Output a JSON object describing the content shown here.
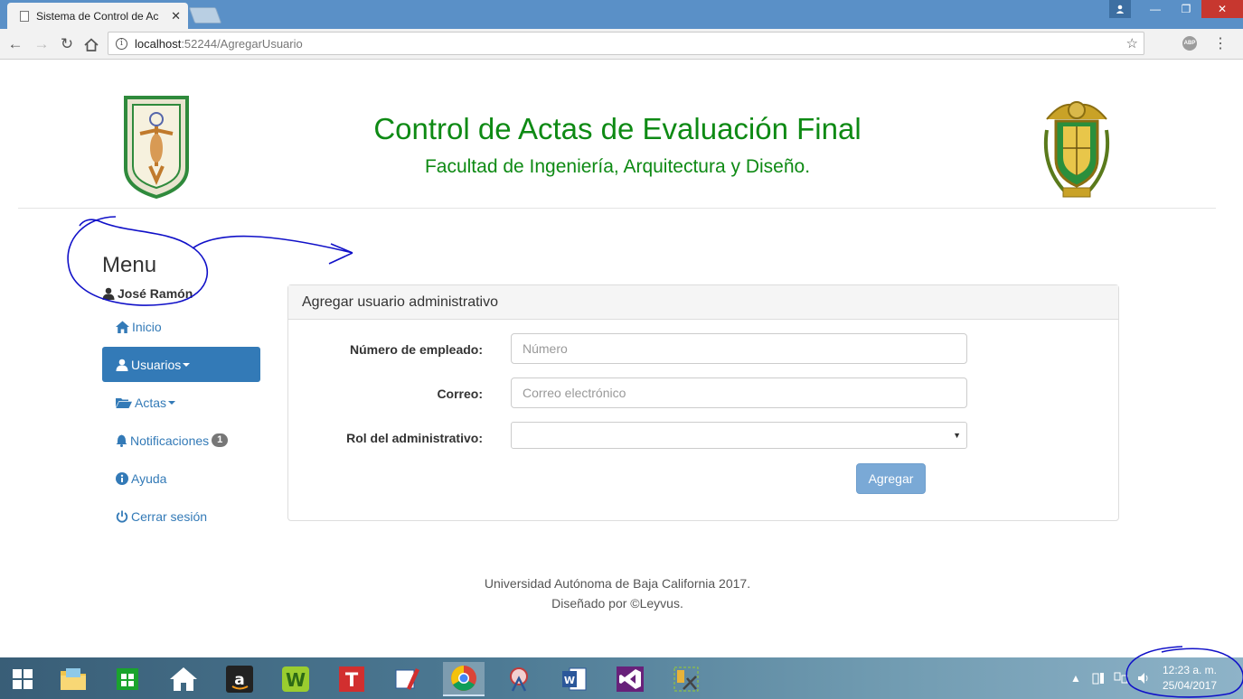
{
  "browser": {
    "tab_title": "Sistema de Control de Ac",
    "url_host": "localhost",
    "url_path": ":52244/AgregarUsuario",
    "abp_label": "ABP"
  },
  "header": {
    "title": "Control de Actas de Evaluación Final",
    "subtitle": "Facultad de Ingeniería, Arquitectura y Diseño."
  },
  "sidebar": {
    "heading": "Menu",
    "user": "José Ramón",
    "items": [
      {
        "label": "Inicio",
        "icon": "home-icon"
      },
      {
        "label": "Usuarios",
        "icon": "user-icon"
      },
      {
        "label": "Actas",
        "icon": "folder-open-icon"
      },
      {
        "label": "Notificaciones",
        "icon": "bell-icon",
        "badge": "1"
      },
      {
        "label": "Ayuda",
        "icon": "info-circle-icon"
      },
      {
        "label": "Cerrar sesión",
        "icon": "power-icon"
      }
    ]
  },
  "panel": {
    "title": "Agregar usuario administrativo",
    "fields": {
      "employee": {
        "label": "Número de empleado:",
        "placeholder": "Número"
      },
      "email": {
        "label": "Correo:",
        "placeholder": "Correo electrónico"
      },
      "role": {
        "label": "Rol del administrativo:",
        "value": ""
      }
    },
    "submit_label": "Agregar"
  },
  "footer": {
    "line1": "Universidad Autónoma de Baja California 2017.",
    "line2": "Diseñado por ©Leyvus."
  },
  "taskbar": {
    "time": "12:23 a. m.",
    "date": "25/04/2017"
  },
  "colors": {
    "brand_green": "#0e8a14",
    "primary_blue": "#337ab7",
    "annotation_ink": "#1010c8"
  }
}
